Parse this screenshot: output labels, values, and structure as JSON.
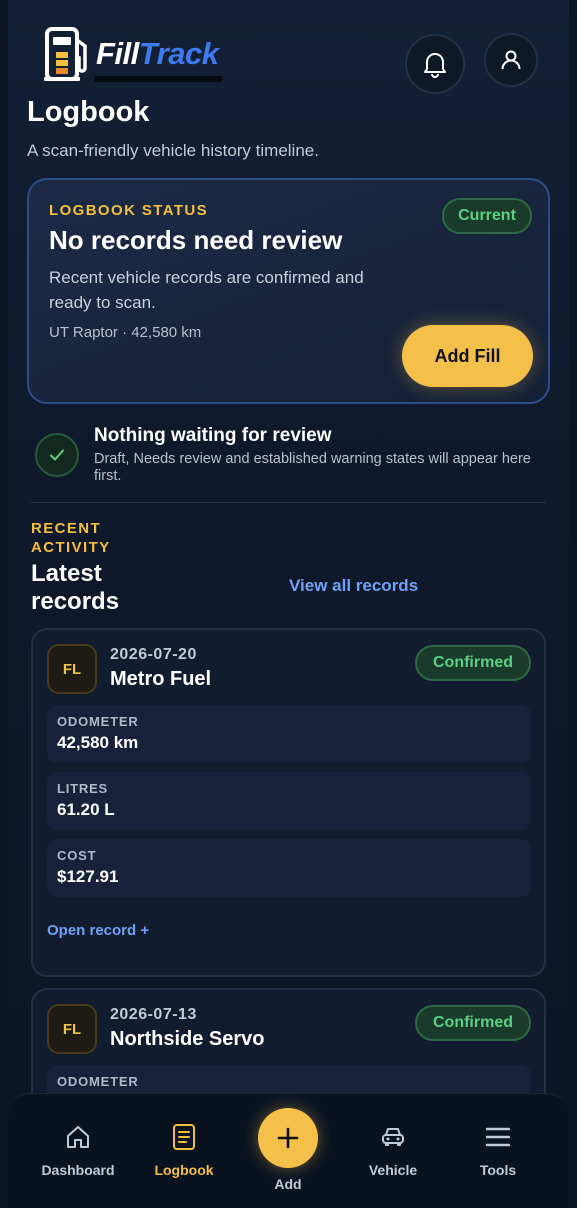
{
  "app": {
    "name_part1": "Fill",
    "name_part2": "Track"
  },
  "header": {
    "title": "Logbook",
    "subtitle": "A scan-friendly vehicle history timeline."
  },
  "status_card": {
    "eyebrow": "LOGBOOK STATUS",
    "badge": "Current",
    "title": "No records need review",
    "description": "Recent vehicle records are confirmed and ready to scan.",
    "vehicle": "UT Raptor · 42,580 km",
    "action_label": "Add Fill"
  },
  "review_notice": {
    "title": "Nothing waiting for review",
    "description": "Draft, Needs review and established warning states will appear here first."
  },
  "recent": {
    "eyebrow": "RECENT ACTIVITY",
    "title": "Latest records",
    "view_all_label": "View all records"
  },
  "records": [
    {
      "badge": "FL",
      "date": "2026-07-20",
      "station": "Metro Fuel",
      "status": "Confirmed",
      "metrics": [
        {
          "label": "ODOMETER",
          "value": "42,580 km"
        },
        {
          "label": "LITRES",
          "value": "61.20 L"
        },
        {
          "label": "COST",
          "value": "$127.91"
        }
      ],
      "open_label": "Open record +"
    },
    {
      "badge": "FL",
      "date": "2026-07-13",
      "station": "Northside Servo",
      "status": "Confirmed",
      "metrics": [
        {
          "label": "ODOMETER",
          "value": ""
        }
      ]
    }
  ],
  "nav": {
    "items": [
      {
        "label": "Dashboard",
        "icon": "home-icon"
      },
      {
        "label": "Logbook",
        "icon": "logbook-icon",
        "active": true
      },
      {
        "label": "Add",
        "icon": "plus-icon"
      },
      {
        "label": "Vehicle",
        "icon": "car-icon"
      },
      {
        "label": "Tools",
        "icon": "menu-icon"
      }
    ]
  },
  "colors": {
    "accent": "#f5c04a",
    "brand_blue": "#3f7bf0",
    "success": "#5bd185",
    "link": "#6fa1f5",
    "background": "#0c1524"
  }
}
